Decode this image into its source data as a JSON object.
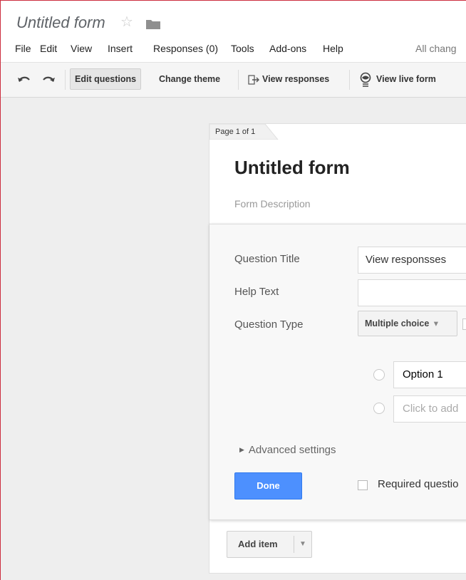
{
  "app": {
    "doc_title": "Untitled form",
    "status": "All chang"
  },
  "menu": [
    "File",
    "Edit",
    "View",
    "Insert",
    "Responses (0)",
    "Tools",
    "Add-ons",
    "Help"
  ],
  "toolbar": {
    "edit_questions": "Edit questions",
    "change_theme": "Change theme",
    "view_responses": "View responses",
    "view_live_form": "View live form"
  },
  "form": {
    "page_label": "Page 1 of 1",
    "title": "Untitled form",
    "description_placeholder": "Form Description"
  },
  "question": {
    "title_label": "Question Title",
    "title_value": "View responsses",
    "help_label": "Help Text",
    "help_value": "",
    "type_label": "Question Type",
    "type_value": "Multiple choice",
    "options": [
      "Option 1"
    ],
    "add_option_placeholder": "Click to add",
    "advanced_settings": "Advanced settings",
    "done_label": "Done",
    "required_label": "Required questio"
  },
  "add_item": {
    "label": "Add item"
  },
  "colors": {
    "primary_blue": "#4d90fe",
    "canvas_bg": "#eeeeee"
  }
}
